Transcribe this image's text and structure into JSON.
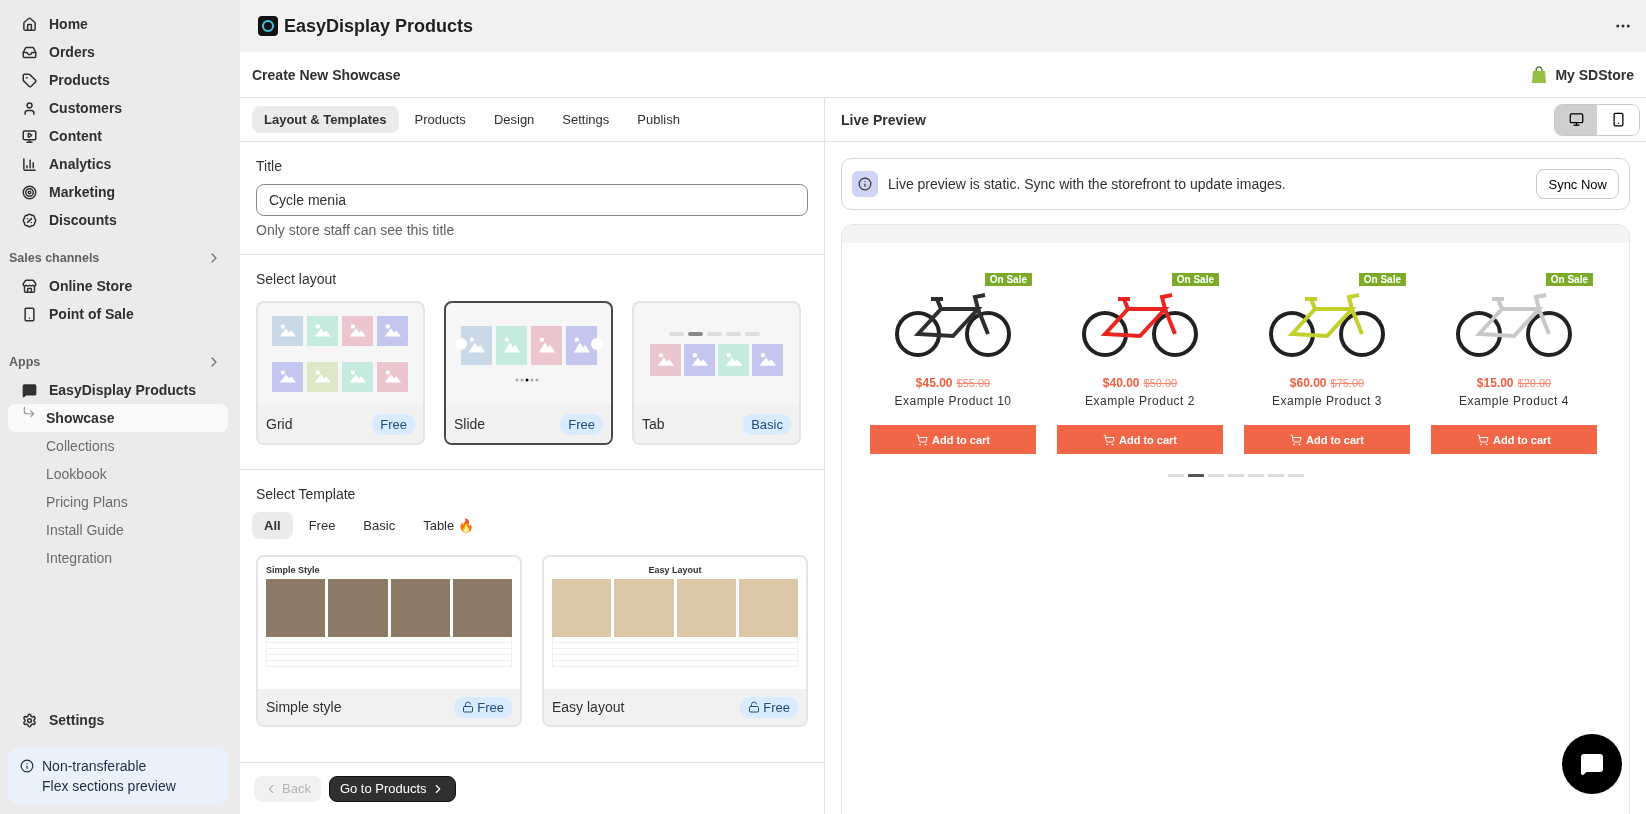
{
  "sidebar": {
    "nav": [
      {
        "label": "Home"
      },
      {
        "label": "Orders"
      },
      {
        "label": "Products"
      },
      {
        "label": "Customers"
      },
      {
        "label": "Content"
      },
      {
        "label": "Analytics"
      },
      {
        "label": "Marketing"
      },
      {
        "label": "Discounts"
      }
    ],
    "sales_channels": {
      "heading": "Sales channels",
      "items": [
        {
          "label": "Online Store"
        },
        {
          "label": "Point of Sale"
        }
      ]
    },
    "apps": {
      "heading": "Apps",
      "app": {
        "label": "EasyDisplay Products",
        "children": [
          {
            "label": "Showcase",
            "selected": true
          },
          {
            "label": "Collections",
            "selected": false
          },
          {
            "label": "Lookbook",
            "selected": false
          },
          {
            "label": "Pricing Plans",
            "selected": false
          },
          {
            "label": "Install Guide",
            "selected": false
          },
          {
            "label": "Integration",
            "selected": false
          }
        ]
      }
    },
    "settings": "Settings",
    "notice": {
      "text": "Non-transferable",
      "link": "Flex sections",
      "suffix": "preview"
    }
  },
  "app_header": {
    "title": "EasyDisplay Products"
  },
  "page": {
    "title": "Create New Showcase",
    "store": "My SDStore"
  },
  "tabs": [
    {
      "label": "Layout & Templates",
      "selected": true
    },
    {
      "label": "Products",
      "selected": false
    },
    {
      "label": "Design",
      "selected": false
    },
    {
      "label": "Settings",
      "selected": false
    },
    {
      "label": "Publish",
      "selected": false
    }
  ],
  "title_field": {
    "label": "Title",
    "value": "Cycle menia",
    "help": "Only store staff can see this title"
  },
  "layouts": {
    "heading": "Select layout",
    "items": [
      {
        "name": "Grid",
        "plan": "Free",
        "selected": false,
        "kind": "grid"
      },
      {
        "name": "Slide",
        "plan": "Free",
        "selected": true,
        "kind": "slide"
      },
      {
        "name": "Tab",
        "plan": "Basic",
        "selected": false,
        "kind": "tab"
      }
    ]
  },
  "templates": {
    "heading": "Select Template",
    "filters": [
      {
        "label": "All",
        "selected": true
      },
      {
        "label": "Free",
        "selected": false
      },
      {
        "label": "Basic",
        "selected": false
      },
      {
        "label": "Table 🔥",
        "selected": false
      }
    ],
    "items": [
      {
        "name": "Simple style",
        "plan": "Free",
        "preview_title": "Simple Style",
        "kind": "simple"
      },
      {
        "name": "Easy layout",
        "plan": "Free",
        "preview_title": "Easy Layout",
        "kind": "easy"
      }
    ]
  },
  "footer": {
    "back": {
      "label": "Back",
      "disabled": true
    },
    "next": "Go to Products"
  },
  "preview": {
    "title": "Live Preview",
    "devices": [
      {
        "kind": "desktop",
        "selected": true
      },
      {
        "kind": "mobile",
        "selected": false
      }
    ],
    "notice": "Live preview is static. Sync with the storefront to update images.",
    "sync": "Sync Now",
    "products": [
      {
        "badge": "On Sale",
        "price": "$45.00",
        "compare": "$55.00",
        "name": "Example Product 10",
        "button": "Add to cart",
        "color": "#2f2f2f"
      },
      {
        "badge": "On Sale",
        "price": "$40.00",
        "compare": "$50.00",
        "name": "Example Product 2",
        "button": "Add to cart",
        "color": "#e8261f"
      },
      {
        "badge": "On Sale",
        "price": "$60.00",
        "compare": "$75.00",
        "name": "Example Product 3",
        "button": "Add to cart",
        "color": "#c3cf2a"
      },
      {
        "badge": "On Sale",
        "price": "$15.00",
        "compare": "$20.00",
        "name": "Example Product 4",
        "button": "Add to cart",
        "color": "#c8c8c8"
      }
    ],
    "pages": [
      {
        "selected": false
      },
      {
        "selected": true
      },
      {
        "selected": false
      },
      {
        "selected": false
      },
      {
        "selected": false
      },
      {
        "selected": false
      },
      {
        "selected": false
      }
    ]
  }
}
